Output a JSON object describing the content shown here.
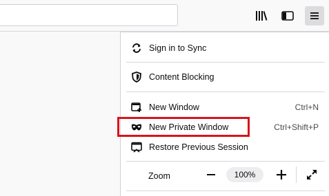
{
  "toolbar": {
    "icons": [
      "library-icon",
      "sidebar-icon",
      "menu-icon"
    ]
  },
  "menu": {
    "sign_in": {
      "label": "Sign in to Sync",
      "icon": "sync-icon"
    },
    "content_blocking": {
      "label": "Content Blocking",
      "icon": "shield-icon"
    },
    "new_window": {
      "label": "New Window",
      "shortcut": "Ctrl+N",
      "icon": "new-window-icon"
    },
    "new_private_window": {
      "label": "New Private Window",
      "shortcut": "Ctrl+Shift+P",
      "icon": "private-mask-icon",
      "highlighted": true
    },
    "restore_session": {
      "label": "Restore Previous Session",
      "icon": "restore-session-icon"
    }
  },
  "zoom": {
    "label": "Zoom",
    "minus": "−",
    "value": "100%",
    "plus": "+"
  },
  "colors": {
    "highlight": "#d7141a",
    "menu_button_bg": "#dcdcde"
  }
}
